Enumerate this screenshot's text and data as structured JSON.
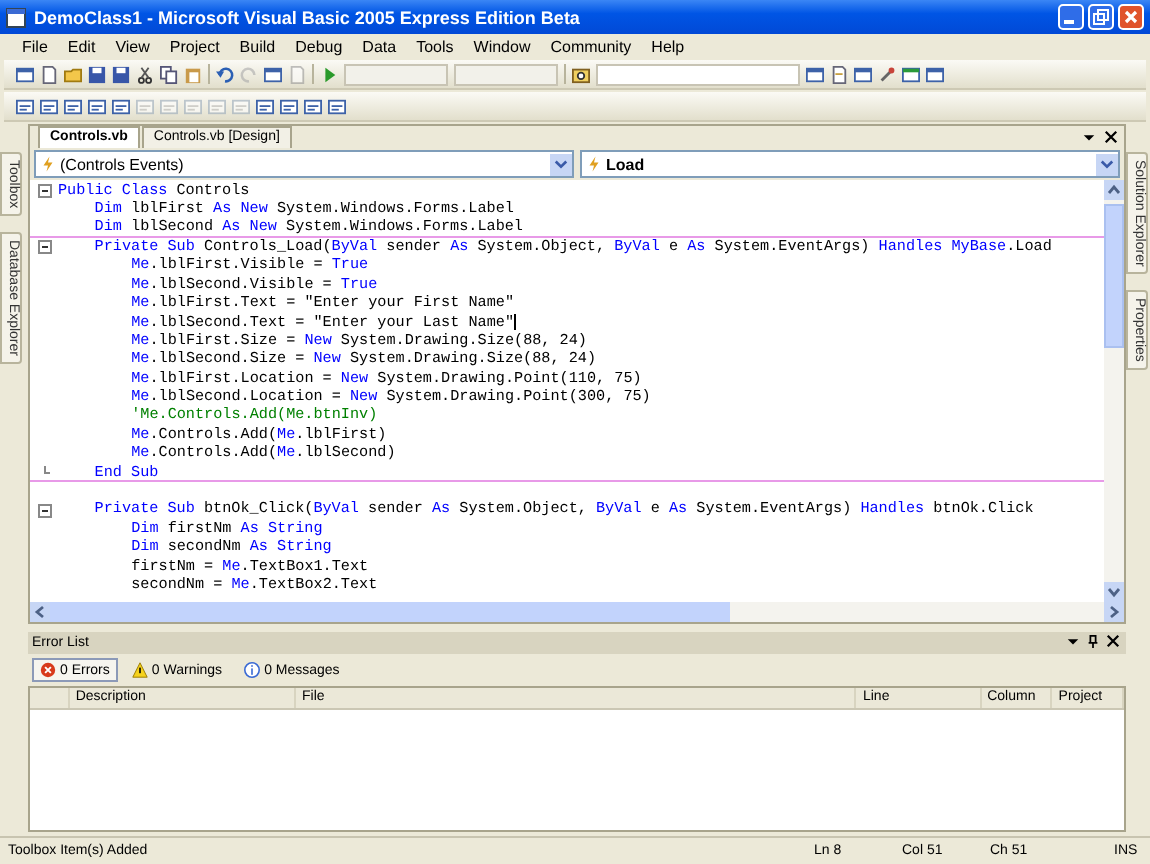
{
  "window": {
    "title": "DemoClass1 - Microsoft Visual Basic 2005 Express Edition Beta"
  },
  "menu": [
    "File",
    "Edit",
    "View",
    "Project",
    "Build",
    "Debug",
    "Data",
    "Tools",
    "Window",
    "Community",
    "Help"
  ],
  "left_dock_tabs": [
    {
      "label": "Toolbox"
    },
    {
      "label": "Database Explorer"
    }
  ],
  "right_dock_tabs": [
    {
      "label": "Solution Explorer"
    },
    {
      "label": "Properties"
    }
  ],
  "document_tabs": [
    {
      "label": "Controls.vb",
      "selected": true
    },
    {
      "label": "Controls.vb [Design]",
      "selected": false
    }
  ],
  "class_dropdown": "(Controls Events)",
  "method_dropdown": "Load",
  "code_lines": [
    {
      "segments": [
        {
          "kind": "keyword",
          "text": "Public Class"
        },
        {
          "kind": "plain",
          "text": " Controls"
        }
      ],
      "children": [
        {
          "segments": [
            {
              "kind": "keyword",
              "text": "Dim"
            },
            {
              "kind": "plain",
              "text": " lblFirst "
            },
            {
              "kind": "keyword",
              "text": "As New"
            },
            {
              "kind": "plain",
              "text": " System.Windows.Forms.Label"
            }
          ]
        },
        {
          "separator_after": true,
          "segments": [
            {
              "kind": "keyword",
              "text": "Dim"
            },
            {
              "kind": "plain",
              "text": " lblSecond "
            },
            {
              "kind": "keyword",
              "text": "As New"
            },
            {
              "kind": "plain",
              "text": " System.Windows.Forms.Label"
            }
          ]
        },
        {
          "segments": [
            {
              "kind": "keyword",
              "text": "Private Sub"
            },
            {
              "kind": "plain",
              "text": " Controls_Load("
            },
            {
              "kind": "keyword",
              "text": "ByVal"
            },
            {
              "kind": "plain",
              "text": " sender "
            },
            {
              "kind": "keyword",
              "text": "As"
            },
            {
              "kind": "plain",
              "text": " System.Object, "
            },
            {
              "kind": "keyword",
              "text": "ByVal"
            },
            {
              "kind": "plain",
              "text": " e "
            },
            {
              "kind": "keyword",
              "text": "As"
            },
            {
              "kind": "plain",
              "text": " System.EventArgs) "
            },
            {
              "kind": "keyword",
              "text": "Handles MyBase"
            },
            {
              "kind": "plain",
              "text": ".Load"
            }
          ],
          "children": [
            {
              "segments": [
                {
                  "kind": "keyword",
                  "text": "Me"
                },
                {
                  "kind": "plain",
                  "text": ".lblFirst.Visible = "
                },
                {
                  "kind": "keyword",
                  "text": "True"
                }
              ]
            },
            {
              "segments": [
                {
                  "kind": "keyword",
                  "text": "Me"
                },
                {
                  "kind": "plain",
                  "text": ".lblSecond.Visible = "
                },
                {
                  "kind": "keyword",
                  "text": "True"
                }
              ]
            },
            {
              "segments": [
                {
                  "kind": "keyword",
                  "text": "Me"
                },
                {
                  "kind": "plain",
                  "text": ".lblFirst.Text = \"Enter your First Name\""
                }
              ]
            },
            {
              "cursor": true,
              "segments": [
                {
                  "kind": "keyword",
                  "text": "Me"
                },
                {
                  "kind": "plain",
                  "text": ".lblSecond.Text = \"Enter your Last Name\""
                }
              ]
            },
            {
              "segments": [
                {
                  "kind": "keyword",
                  "text": "Me"
                },
                {
                  "kind": "plain",
                  "text": ".lblFirst.Size = "
                },
                {
                  "kind": "keyword",
                  "text": "New"
                },
                {
                  "kind": "plain",
                  "text": " System.Drawing.Size(88, 24)"
                }
              ]
            },
            {
              "segments": [
                {
                  "kind": "keyword",
                  "text": "Me"
                },
                {
                  "kind": "plain",
                  "text": ".lblSecond.Size = "
                },
                {
                  "kind": "keyword",
                  "text": "New"
                },
                {
                  "kind": "plain",
                  "text": " System.Drawing.Size(88, 24)"
                }
              ]
            },
            {
              "segments": [
                {
                  "kind": "keyword",
                  "text": "Me"
                },
                {
                  "kind": "plain",
                  "text": ".lblFirst.Location = "
                },
                {
                  "kind": "keyword",
                  "text": "New"
                },
                {
                  "kind": "plain",
                  "text": " System.Drawing.Point(110, 75)"
                }
              ]
            },
            {
              "segments": [
                {
                  "kind": "keyword",
                  "text": "Me"
                },
                {
                  "kind": "plain",
                  "text": ".lblSecond.Location = "
                },
                {
                  "kind": "keyword",
                  "text": "New"
                },
                {
                  "kind": "plain",
                  "text": " System.Drawing.Point(300, 75)"
                }
              ]
            },
            {
              "segments": [
                {
                  "kind": "comment",
                  "text": "'Me.Controls.Add(Me.btnInv)"
                }
              ]
            },
            {
              "segments": [
                {
                  "kind": "keyword",
                  "text": "Me"
                },
                {
                  "kind": "plain",
                  "text": ".Controls.Add("
                },
                {
                  "kind": "keyword",
                  "text": "Me"
                },
                {
                  "kind": "plain",
                  "text": ".lblFirst)"
                }
              ]
            },
            {
              "segments": [
                {
                  "kind": "keyword",
                  "text": "Me"
                },
                {
                  "kind": "plain",
                  "text": ".Controls.Add("
                },
                {
                  "kind": "keyword",
                  "text": "Me"
                },
                {
                  "kind": "plain",
                  "text": ".lblSecond)"
                }
              ]
            }
          ],
          "end": {
            "separator_after": true,
            "blank_line_after": true,
            "segments": [
              {
                "kind": "keyword",
                "text": "End Sub"
              }
            ]
          }
        },
        {
          "segments": [
            {
              "kind": "keyword",
              "text": "Private Sub"
            },
            {
              "kind": "plain",
              "text": " btnOk_Click("
            },
            {
              "kind": "keyword",
              "text": "ByVal"
            },
            {
              "kind": "plain",
              "text": " sender "
            },
            {
              "kind": "keyword",
              "text": "As"
            },
            {
              "kind": "plain",
              "text": " System.Object, "
            },
            {
              "kind": "keyword",
              "text": "ByVal"
            },
            {
              "kind": "plain",
              "text": " e "
            },
            {
              "kind": "keyword",
              "text": "As"
            },
            {
              "kind": "plain",
              "text": " System.EventArgs) "
            },
            {
              "kind": "keyword",
              "text": "Handles"
            },
            {
              "kind": "plain",
              "text": " btnOk.Click"
            }
          ],
          "children": [
            {
              "segments": [
                {
                  "kind": "keyword",
                  "text": "Dim"
                },
                {
                  "kind": "plain",
                  "text": " firstNm "
                },
                {
                  "kind": "keyword",
                  "text": "As String"
                }
              ]
            },
            {
              "segments": [
                {
                  "kind": "keyword",
                  "text": "Dim"
                },
                {
                  "kind": "plain",
                  "text": " secondNm "
                },
                {
                  "kind": "keyword",
                  "text": "As String"
                }
              ]
            },
            {
              "segments": [
                {
                  "kind": "plain",
                  "text": "firstNm = "
                },
                {
                  "kind": "keyword",
                  "text": "Me"
                },
                {
                  "kind": "plain",
                  "text": ".TextBox1.Text"
                }
              ]
            },
            {
              "segments": [
                {
                  "kind": "plain",
                  "text": "secondNm = "
                },
                {
                  "kind": "keyword",
                  "text": "Me"
                },
                {
                  "kind": "plain",
                  "text": ".TextBox2.Text"
                }
              ]
            }
          ]
        }
      ]
    }
  ],
  "error_list": {
    "title": "Error List",
    "filters": [
      {
        "kind": "error",
        "label": "0 Errors",
        "selected": true
      },
      {
        "kind": "warning",
        "label": "0 Warnings",
        "selected": false
      },
      {
        "kind": "message",
        "label": "0 Messages",
        "selected": false
      }
    ],
    "columns": [
      "Description",
      "File",
      "Line",
      "Column",
      "Project"
    ]
  },
  "status_bar": {
    "message": "Toolbox Item(s) Added",
    "line": "Ln 8",
    "column": "Col 51",
    "character": "Ch 51",
    "mode": "INS"
  }
}
